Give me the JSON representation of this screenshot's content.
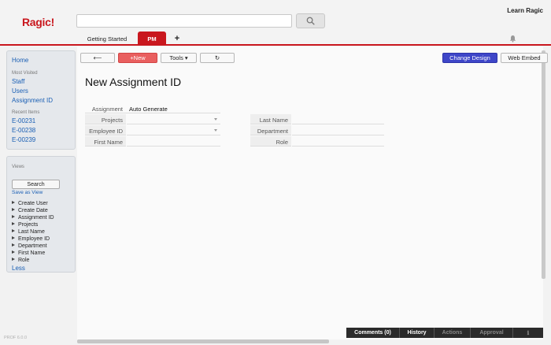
{
  "header": {
    "logo": "Ragic!",
    "search_placeholder": "",
    "learn_link": "Learn Ragic",
    "tabs": [
      {
        "label": "Getting Started"
      },
      {
        "label": "PM"
      },
      {
        "label": "+"
      }
    ]
  },
  "sidebar": {
    "home": "Home",
    "most_visited_heading": "Most Visited",
    "most_visited": [
      "Staff",
      "Users",
      "Assignment ID"
    ],
    "recent_heading": "Recent Items",
    "recent": [
      "E-00231",
      "E-00238",
      "E-00239"
    ],
    "views_heading": "Views",
    "search_button": "Search",
    "save_as_view": "Save as View",
    "fields": [
      "Create User",
      "Create Date",
      "Assignment ID",
      "Projects",
      "Last Name",
      "Employee ID",
      "Department",
      "First Name",
      "Role"
    ],
    "less": "Less",
    "version": "PROF 6.0.0"
  },
  "toolbar": {
    "back_label": "⟵",
    "new_label": "+New",
    "tools_label": "Tools ▾",
    "refresh_label": "↻",
    "change_design_label": "Change Design",
    "web_embed_label": "Web Embed"
  },
  "form": {
    "title": "New Assignment ID",
    "left_fields": [
      {
        "label": "Assignment ID",
        "value": "Auto Generate"
      },
      {
        "label": "Projects",
        "value": ""
      },
      {
        "label": "Employee ID",
        "value": ""
      },
      {
        "label": "First Name",
        "value": ""
      }
    ],
    "right_fields": [
      {
        "label": "Last Name",
        "value": ""
      },
      {
        "label": "Department",
        "value": ""
      },
      {
        "label": "Role",
        "value": ""
      }
    ]
  },
  "bottom_bar": {
    "comments": "Comments (0)",
    "history": "History",
    "actions": "Actions",
    "approval": "Approval",
    "info": "ℹ"
  },
  "colors": {
    "brand_red": "#c9171e",
    "change_design_blue": "#3e46c8",
    "new_button_red": "#e95f5f",
    "link_blue": "#1a5fb4"
  }
}
